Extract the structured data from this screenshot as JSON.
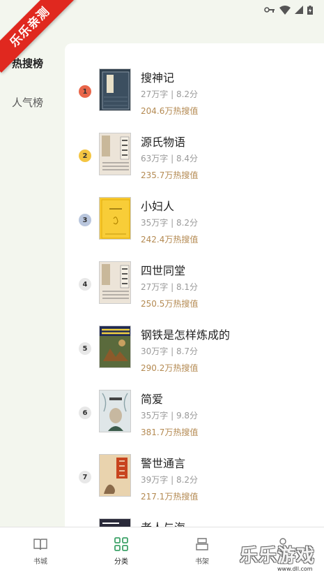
{
  "watermark": {
    "ribbon": "乐乐亲测",
    "logo": "乐乐游戏",
    "url": "www.dll.com"
  },
  "side_tabs": [
    {
      "label": "热搜榜",
      "active": true
    },
    {
      "label": "人气榜",
      "active": false
    }
  ],
  "books": [
    {
      "rank": "1",
      "title": "搜神记",
      "meta": "27万字 | 8.2分",
      "heat": "204.6万热搜值",
      "badge_color": "#e9664a",
      "cover_bg": "#31414f",
      "cover_text": "搜神记",
      "cover_text_color": "#e8e0c8"
    },
    {
      "rank": "2",
      "title": "源氏物语",
      "meta": "63万字 | 8.4分",
      "heat": "235.7万热搜值",
      "badge_color": "#f4c542",
      "cover_bg": "#ece4d8",
      "cover_text": "四世同堂",
      "cover_text_color": "#333"
    },
    {
      "rank": "3",
      "title": "小妇人",
      "meta": "35万字 | 8.2分",
      "heat": "242.4万热搜值",
      "badge_color": "#b9c6dd",
      "cover_bg": "#f7c830",
      "cover_text": "小妇人",
      "cover_text_color": "#7a5a00"
    },
    {
      "rank": "4",
      "title": "四世同堂",
      "meta": "27万字 | 8.1分",
      "heat": "250.5万热搜值",
      "badge_color": "#e8e8e8",
      "cover_bg": "#ece4d8",
      "cover_text": "四世同堂",
      "cover_text_color": "#333"
    },
    {
      "rank": "5",
      "title": "钢铁是怎样炼成的",
      "meta": "30万字 | 8.7分",
      "heat": "290.2万热搜值",
      "badge_color": "#e8e8e8",
      "cover_bg": "#2c3a6b",
      "cover_text": "",
      "cover_text_color": "#f0d040"
    },
    {
      "rank": "6",
      "title": "简爱",
      "meta": "35万字 | 9.8分",
      "heat": "381.7万热搜值",
      "badge_color": "#e8e8e8",
      "cover_bg": "#dfe6e8",
      "cover_text": "",
      "cover_text_color": "#333"
    },
    {
      "rank": "7",
      "title": "警世通言",
      "meta": "39万字 | 8.2分",
      "heat": "217.1万热搜值",
      "badge_color": "#e8e8e8",
      "cover_bg": "#c8441e",
      "cover_text": "",
      "cover_text_color": "#f4e8c8"
    },
    {
      "rank": "",
      "title": "老人与海",
      "meta": "",
      "heat": "",
      "badge_color": "#e8e8e8",
      "cover_bg": "#3a3a4a",
      "cover_text": "",
      "cover_text_color": "#fff"
    }
  ],
  "bottom_nav": [
    {
      "label": "书城",
      "icon": "book-open-icon",
      "active": false
    },
    {
      "label": "分类",
      "icon": "category-grid-icon",
      "active": true
    },
    {
      "label": "书架",
      "icon": "bookshelf-icon",
      "active": false
    },
    {
      "label": "",
      "icon": "profile-icon",
      "active": false
    }
  ],
  "colors": {
    "accent": "#3fa36a",
    "heat": "#b48a52"
  }
}
